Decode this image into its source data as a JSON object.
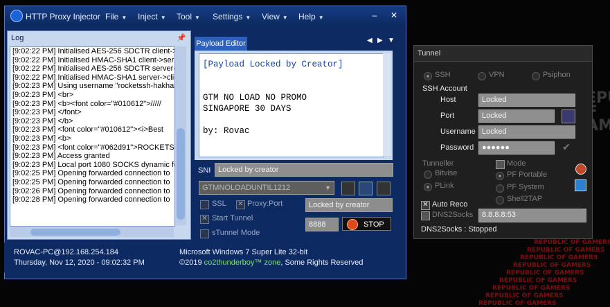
{
  "window": {
    "title": "HTTP Proxy Injector",
    "menus": [
      "File",
      "Inject",
      "Tool",
      "Settings",
      "View",
      "Help"
    ]
  },
  "log": {
    "title": "Log",
    "lines": [
      "[9:02:22 PM] Initialised AES-256 SDCTR client->",
      "[9:02:22 PM] Initialised HMAC-SHA1 client->ser",
      "[9:02:22 PM] Initialised AES-256 SDCTR server->",
      "[9:02:22 PM] Initialised HMAC-SHA1 server->clie",
      "[9:02:23 PM] Using username \"rocketssh-hakhal",
      "[9:02:23 PM]  <br>",
      "[9:02:23 PM]  <b><font color=\"#010612\">/////",
      "[9:02:23 PM]  </font>",
      "[9:02:23 PM]  </b>",
      "[9:02:23 PM]  <font color=\"#010612\"><i>Best",
      "[9:02:23 PM]  <b>",
      "[9:02:23 PM]  <font color=\"#062d91\">ROCKETS",
      "[9:02:23 PM] Access granted",
      "[9:02:23 PM] Local port 1080 SOCKS dynamic fo",
      "[9:02:25 PM] Opening forwarded connection to",
      "[9:02:25 PM] Opening forwarded connection to",
      "[9:02:26 PM] Opening forwarded connection to",
      "[9:02:28 PM] Opening forwarded connection to"
    ]
  },
  "payload": {
    "tab_label": "Payload Editor",
    "lines": [
      "[Payload Locked by Creator]",
      "",
      "",
      "GTM NO LOAD NO PROMO",
      "SINGAPORE 30 DAYS",
      "",
      "by: Rovac"
    ]
  },
  "sni": {
    "label": "SNI",
    "value": "Locked by creator"
  },
  "server_select": "GTMNOLOADUNTIL1212",
  "options": {
    "ssl": "SSL",
    "proxy_port": "Proxy:Port",
    "start_tunnel": "Start Tunnel",
    "stunnel_mode": "sTunnel Mode",
    "proxy_value": "Locked by creator",
    "port_value": "8888",
    "stop_label": "STOP"
  },
  "status": {
    "pc": "ROVAC-PC@192.168.254.184",
    "datetime": "Thursday, Nov 12, 2020 - 09:02:32 PM",
    "os": "Microsoft Windows 7 Super Lite  32-bit",
    "copyright_prefix": "©2019",
    "brand": "co2thunderboy™ zone",
    "copyright_suffix": ", Some Rights Reserved"
  },
  "tunnel": {
    "title": "Tunnel",
    "modes": [
      "SSH",
      "VPN",
      "Psiphon"
    ],
    "ssh_account_label": "SSH Account",
    "host_label": "Host",
    "host_value": "Locked",
    "port_label": "Port",
    "port_value": "Locked",
    "username_label": "Username",
    "username_value": "Locked",
    "password_label": "Password",
    "password_value": "●●●●●●",
    "tunneller_label": "Tunneller",
    "tunneller_options": [
      "Bitvise",
      "PLink"
    ],
    "mode_label": "Mode",
    "mode_options": [
      "PF Portable",
      "PF System",
      "Shell2TAP"
    ],
    "auto_reco": "Auto Reco",
    "dns2socks": "DNS2Socks",
    "dns_value": "8.8.8.8:53",
    "dns_status": "DNS2Socks : Stopped"
  },
  "background": {
    "repeat_text": "REPUBLIC OF GAMERS"
  }
}
